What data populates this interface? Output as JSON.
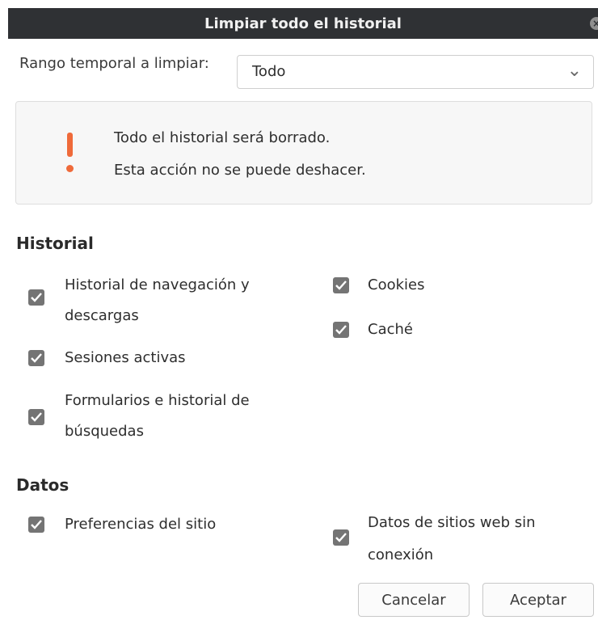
{
  "window": {
    "title": "Limpiar todo el historial",
    "close_glyph": "×"
  },
  "range": {
    "label": "Rango temporal a limpiar:",
    "selected": "Todo",
    "chevron": "⌄"
  },
  "warning": {
    "icon": "exclamation-icon",
    "line1": "Todo el historial será borrado.",
    "line2": "Esta acción no se puede deshacer.",
    "accent": "#ef6a3a"
  },
  "historial": {
    "title": "Historial",
    "items": [
      {
        "label_line1": "Historial de navegación y",
        "label_line2": "descargas",
        "checked": true
      },
      {
        "label": "Sesiones activas",
        "checked": true
      },
      {
        "label_line1": "Formularios e historial de",
        "label_line2": "búsquedas",
        "checked": true
      },
      {
        "label": "Cookies",
        "checked": true
      },
      {
        "label": "Caché",
        "checked": true
      }
    ]
  },
  "datos": {
    "title": "Datos",
    "items": [
      {
        "label": "Preferencias del sitio",
        "checked": true
      },
      {
        "label_line1": "Datos de sitios web sin",
        "label_line2": "conexión",
        "checked": true
      }
    ]
  },
  "buttons": {
    "cancel": "Cancelar",
    "accept": "Aceptar"
  }
}
